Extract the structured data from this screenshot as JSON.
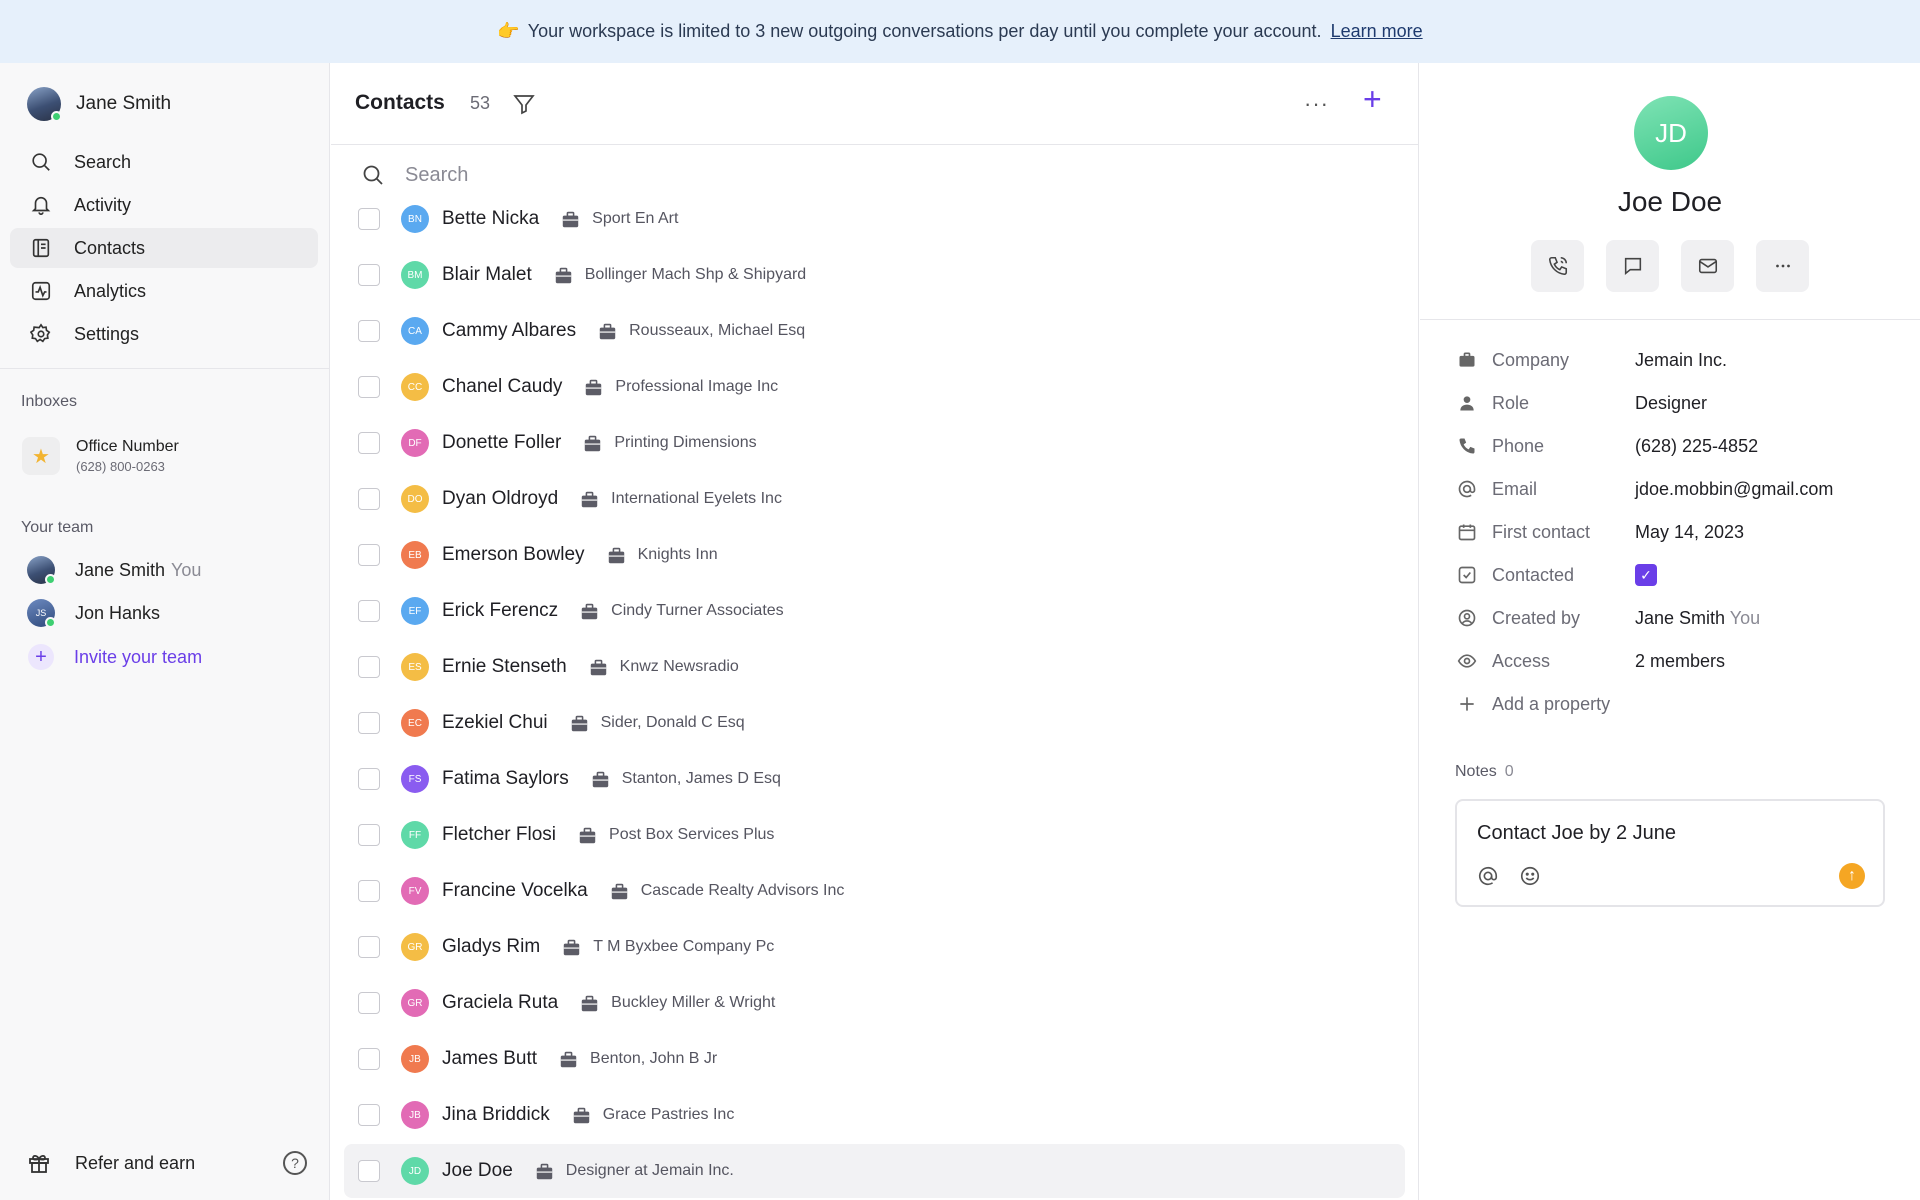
{
  "banner": {
    "emoji": "👉",
    "message": "Your workspace is limited to 3 new outgoing conversations per day until you complete your account.",
    "link": "Learn more"
  },
  "sidebar": {
    "user_name": "Jane Smith",
    "nav": [
      {
        "label": "Search",
        "icon": "search-icon"
      },
      {
        "label": "Activity",
        "icon": "bell-icon"
      },
      {
        "label": "Contacts",
        "icon": "contacts-icon",
        "active": true
      },
      {
        "label": "Analytics",
        "icon": "analytics-icon"
      },
      {
        "label": "Settings",
        "icon": "gear-icon"
      }
    ],
    "inboxes_label": "Inboxes",
    "inbox": {
      "name": "Office Number",
      "number": "(628) 800-0263",
      "icon": "star-icon"
    },
    "team_label": "Your team",
    "team": [
      {
        "name": "Jane Smith",
        "suffix": "You"
      },
      {
        "name": "Jon Hanks",
        "initials": "JS"
      }
    ],
    "invite": "Invite your team",
    "refer": "Refer and earn",
    "help": "?"
  },
  "contacts": {
    "title": "Contacts",
    "count": "53",
    "more": "···",
    "add": "+",
    "search_placeholder": "Search",
    "rows": [
      {
        "initials": "BN",
        "name": "Bette Nicka",
        "company": "Sport En Art",
        "color": "#5aa9f0"
      },
      {
        "initials": "BM",
        "name": "Blair Malet",
        "company": "Bollinger Mach Shp & Shipyard",
        "color": "#5fd9a8"
      },
      {
        "initials": "CA",
        "name": "Cammy Albares",
        "company": "Rousseaux, Michael Esq",
        "color": "#5aa9f0"
      },
      {
        "initials": "CC",
        "name": "Chanel Caudy",
        "company": "Professional Image Inc",
        "color": "#f4bd45"
      },
      {
        "initials": "DF",
        "name": "Donette Foller",
        "company": "Printing Dimensions",
        "color": "#e26bb5"
      },
      {
        "initials": "DO",
        "name": "Dyan Oldroyd",
        "company": "International Eyelets Inc",
        "color": "#f4bd45"
      },
      {
        "initials": "EB",
        "name": "Emerson Bowley",
        "company": "Knights Inn",
        "color": "#f07a4f"
      },
      {
        "initials": "EF",
        "name": "Erick Ferencz",
        "company": "Cindy Turner Associates",
        "color": "#5aa9f0"
      },
      {
        "initials": "ES",
        "name": "Ernie Stenseth",
        "company": "Knwz Newsradio",
        "color": "#f4bd45"
      },
      {
        "initials": "EC",
        "name": "Ezekiel Chui",
        "company": "Sider, Donald C Esq",
        "color": "#f07a4f"
      },
      {
        "initials": "FS",
        "name": "Fatima Saylors",
        "company": "Stanton, James D Esq",
        "color": "#8a5cf0"
      },
      {
        "initials": "FF",
        "name": "Fletcher Flosi",
        "company": "Post Box Services Plus",
        "color": "#5fd9a8"
      },
      {
        "initials": "FV",
        "name": "Francine Vocelka",
        "company": "Cascade Realty Advisors Inc",
        "color": "#e26bb5"
      },
      {
        "initials": "GR",
        "name": "Gladys Rim",
        "company": "T M Byxbee Company Pc",
        "color": "#f4bd45"
      },
      {
        "initials": "GR",
        "name": "Graciela Ruta",
        "company": "Buckley Miller & Wright",
        "color": "#e26bb5"
      },
      {
        "initials": "JB",
        "name": "James Butt",
        "company": "Benton, John B Jr",
        "color": "#f07a4f"
      },
      {
        "initials": "JB",
        "name": "Jina Briddick",
        "company": "Grace Pastries Inc",
        "color": "#e26bb5"
      },
      {
        "initials": "JD",
        "name": "Joe Doe",
        "company": "Designer at Jemain Inc.",
        "color": "#5fd9a8",
        "selected": true
      }
    ]
  },
  "detail": {
    "initials": "JD",
    "name": "Joe Doe",
    "actions": [
      "phone-icon",
      "message-icon",
      "mail-icon",
      "more-icon"
    ],
    "properties": [
      {
        "label": "Company",
        "value": "Jemain Inc.",
        "icon": "briefcase-icon"
      },
      {
        "label": "Role",
        "value": "Designer",
        "icon": "person-icon"
      },
      {
        "label": "Phone",
        "value": "(628) 225-4852",
        "icon": "phone-icon"
      },
      {
        "label": "Email",
        "value": "jdoe.mobbin@gmail.com",
        "icon": "at-icon"
      },
      {
        "label": "First contact",
        "value": "May 14, 2023",
        "icon": "calendar-icon"
      },
      {
        "label": "Contacted",
        "value": "",
        "icon": "checkbox-icon",
        "checked": true
      },
      {
        "label": "Created by",
        "value": "Jane Smith",
        "value_suffix": "You",
        "icon": "user-circle-icon"
      },
      {
        "label": "Access",
        "value": "2 members",
        "icon": "eye-icon"
      },
      {
        "label": "Add a property",
        "value": "",
        "icon": "plus-icon"
      }
    ],
    "notes_label": "Notes",
    "notes_count": "0",
    "note_text": "Contact Joe by 2 June",
    "send_icon": "↑"
  },
  "colors": {
    "accent": "#6a3ee8",
    "banner_bg": "#e6f0fb",
    "send": "#f5a623"
  }
}
